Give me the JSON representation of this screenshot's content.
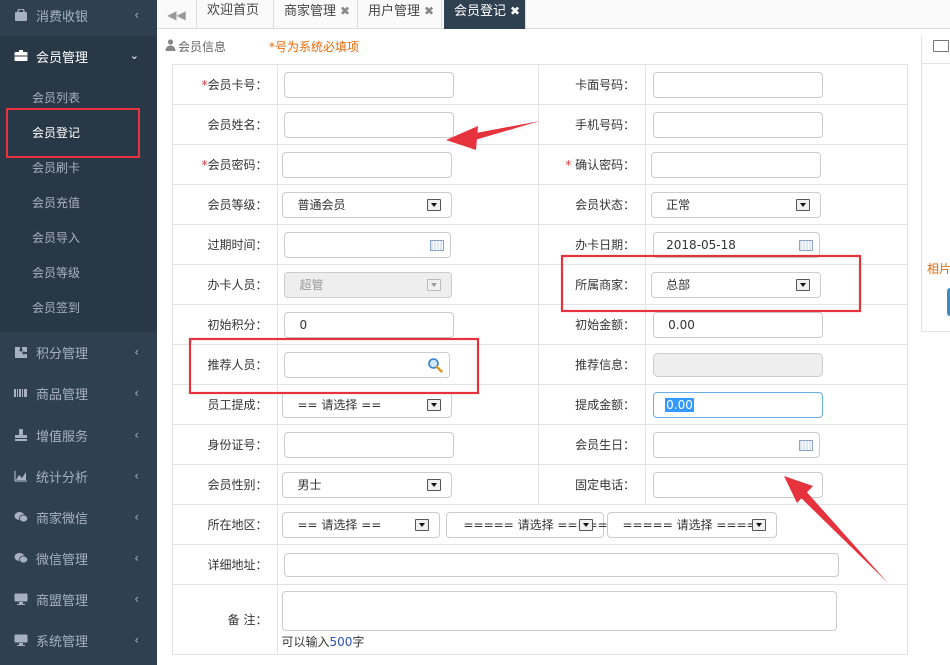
{
  "sidebar": {
    "items": [
      {
        "label": "消费收银",
        "icon": "shopping-bag-icon"
      },
      {
        "label": "会员管理",
        "icon": "id-card-icon",
        "open": true
      },
      {
        "label": "积分管理",
        "icon": "puzzle-icon"
      },
      {
        "label": "商品管理",
        "icon": "barcode-icon"
      },
      {
        "label": "增值服务",
        "icon": "stamp-icon"
      },
      {
        "label": "统计分析",
        "icon": "area-chart-icon"
      },
      {
        "label": "商家微信",
        "icon": "wechat-icon"
      },
      {
        "label": "微信管理",
        "icon": "wechat-icon"
      },
      {
        "label": "商盟管理",
        "icon": "desktop-icon"
      },
      {
        "label": "系统管理",
        "icon": "desktop-icon"
      }
    ],
    "submenu": [
      "会员列表",
      "会员登记",
      "会员刷卡",
      "会员充值",
      "会员导入",
      "会员等级",
      "会员签到"
    ],
    "active_sub": "会员登记"
  },
  "tabs": [
    {
      "label": "欢迎首页",
      "closable": false
    },
    {
      "label": "商家管理",
      "closable": true
    },
    {
      "label": "用户管理",
      "closable": true
    },
    {
      "label": "会员登记",
      "closable": true,
      "active": true
    }
  ],
  "panel": {
    "title": "会员信息",
    "required_note": "*号为系统必填项"
  },
  "form": {
    "card_no_label": "会员卡号：",
    "face_no_label": "卡面号码：",
    "name_label": "会员姓名：",
    "phone_label": "手机号码：",
    "password_label": "会员密码：",
    "confirm_label": "确认密码：",
    "level_label": "会员等级：",
    "level_value": "普通会员",
    "status_label": "会员状态：",
    "status_value": "正常",
    "expire_label": "过期时间：",
    "card_date_label": "办卡日期：",
    "card_date_value": "2018-05-18",
    "operator_label": "办卡人员：",
    "operator_value": "超管",
    "merchant_label": "所属商家：",
    "merchant_value": "总部",
    "init_points_label": "初始积分：",
    "init_points_value": "0",
    "init_amount_label": "初始金额：",
    "init_amount_value": "0.00",
    "referrer_label": "推荐人员：",
    "referrer_info_label": "推荐信息：",
    "commission_staff_label": "员工提成：",
    "commission_staff_value": "== 请选择 ==",
    "commission_amount_label": "提成金额：",
    "commission_amount_value": "0.00",
    "id_card_label": "身份证号：",
    "birthday_label": "会员生日：",
    "gender_label": "会员性别：",
    "gender_value": "男士",
    "tel_label": "固定电话：",
    "region_label": "所在地区：",
    "region_province": "== 请选择 ==",
    "region_city": "===== 请选择 =====",
    "region_district": "===== 请选择 =====",
    "address_label": "详细地址：",
    "remark_label": "备  注：",
    "remark_hint_prefix": "可以输入",
    "remark_hint_count": "500",
    "remark_hint_suffix": "字"
  },
  "right_panel": {
    "label": "相片"
  },
  "colors": {
    "sidebar_bg": "#2f4050",
    "accent_red": "#e5323c",
    "note_orange": "#e46a0a"
  }
}
